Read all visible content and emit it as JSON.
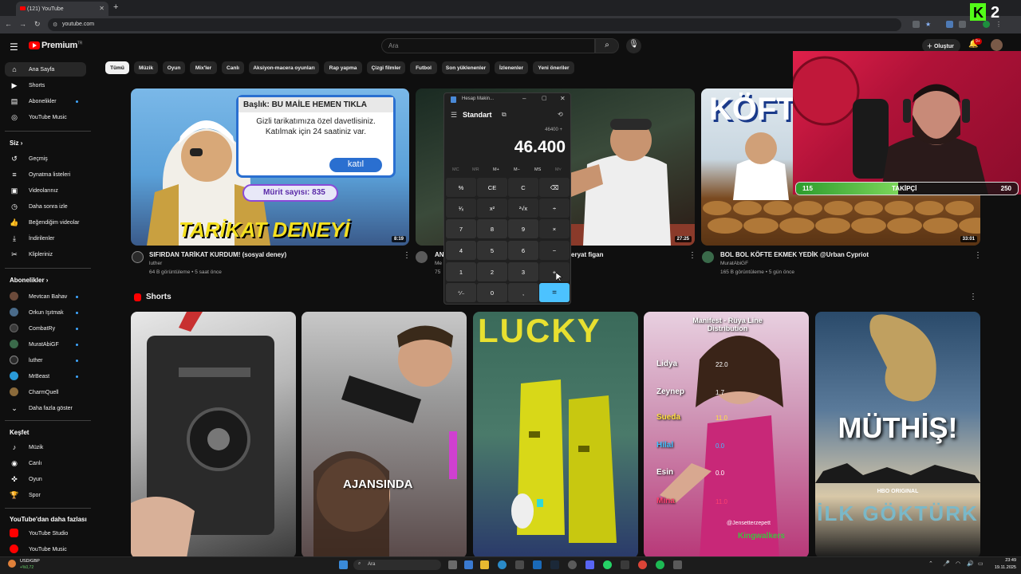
{
  "browser": {
    "tab_title": "(121) YouTube",
    "new_tab": "+",
    "url": "youtube.com"
  },
  "header": {
    "brand": "Premium",
    "brand_sup": "TR",
    "search_placeholder": "Ara",
    "create_label": "Oluştur",
    "notif_count": "9+"
  },
  "chips": [
    "Tümü",
    "Müzik",
    "Oyun",
    "Mix'ler",
    "Canlı",
    "Aksiyon-macera oyunları",
    "Rap yapma",
    "Çizgi filmler",
    "Futbol",
    "Son yüklenenler",
    "İzlenenler",
    "Yeni öneriler"
  ],
  "sidebar": {
    "main": [
      {
        "label": "Ana Sayfa",
        "icon": "home-icon"
      },
      {
        "label": "Shorts",
        "icon": "shorts-icon"
      },
      {
        "label": "Abonelikler",
        "icon": "subscriptions-icon"
      },
      {
        "label": "YouTube Music",
        "icon": "music-icon"
      }
    ],
    "you_header": "Siz",
    "you": [
      {
        "label": "Geçmiş",
        "icon": "history-icon"
      },
      {
        "label": "Oynatma listeleri",
        "icon": "playlist-icon"
      },
      {
        "label": "Videolarınız",
        "icon": "your-videos-icon"
      },
      {
        "label": "Daha sonra izle",
        "icon": "watch-later-icon"
      },
      {
        "label": "Beğendiğim videolar",
        "icon": "like-icon"
      },
      {
        "label": "İndirilenler",
        "icon": "download-icon"
      },
      {
        "label": "Klipleriniz",
        "icon": "clips-icon"
      }
    ],
    "subs_header": "Abonelikler",
    "subs": [
      {
        "label": "Mevtcan Bahav",
        "color": "#6b4a3a"
      },
      {
        "label": "Orkun Işıtmak",
        "color": "#4a6b8a"
      },
      {
        "label": "CombatRy",
        "color": "#3a3a3a"
      },
      {
        "label": "MuratAbiGF",
        "color": "#3a6a4a"
      },
      {
        "label": "luther",
        "color": "#2a2a2a"
      },
      {
        "label": "MrBeast",
        "color": "#2a9ad8"
      },
      {
        "label": "CharmQuell",
        "color": "#8a6a3a"
      }
    ],
    "show_more": "Daha fazla göster",
    "explore_header": "Keşfet",
    "explore": [
      {
        "label": "Müzik",
        "icon": "music-note-icon"
      },
      {
        "label": "Canlı",
        "icon": "live-icon"
      },
      {
        "label": "Oyun",
        "icon": "gaming-icon"
      },
      {
        "label": "Spor",
        "icon": "trophy-icon"
      }
    ],
    "more_header": "YouTube'dan daha fazlası",
    "more": [
      {
        "label": "YouTube Studio"
      },
      {
        "label": "YouTube Music"
      }
    ]
  },
  "videos": [
    {
      "title": "SIFIRDAN TARİKAT KURDUM! (sosyal deney)",
      "channel": "luther",
      "meta": "64 B görüntüleme • 5 saat önce",
      "duration": "8:19",
      "thumb_text": {
        "heading": "Başlık: BU MAİLE HEMEN TIKLA",
        "body1": "Gizli tarikatımıza özel davetlisiniz.",
        "body2": "Katılmak için 24 saatiniz var.",
        "button": "katıl",
        "badge": "Mürit sayısı: 835",
        "caption": "TARİKAT DENEYİ"
      }
    },
    {
      "title": "AN",
      "channel": "Me",
      "meta": "75",
      "duration": "27:25",
      "title_tail": "eryat figan"
    },
    {
      "title": "BOL BOL KÖFTE EKMEK YEDİK @Urban Cypriot",
      "channel": "MuratAbiGF",
      "meta": "165 B görüntüleme • 5 gün önce",
      "duration": "33:01",
      "thumb_caption": "KÖFT"
    }
  ],
  "calculator": {
    "title": "Hesap Makin...",
    "mode": "Standart",
    "expression": "46400 +",
    "display": "46.400",
    "memory": [
      "MC",
      "MR",
      "M+",
      "M−",
      "MS",
      "M˅"
    ],
    "keys": [
      [
        "%",
        "CE",
        "C",
        "⌫"
      ],
      [
        "¹⁄ₓ",
        "x²",
        "²√x",
        "÷"
      ],
      [
        "7",
        "8",
        "9",
        "×"
      ],
      [
        "4",
        "5",
        "6",
        "−"
      ],
      [
        "1",
        "2",
        "3",
        "+"
      ],
      [
        "⁺⁄₋",
        "0",
        ",",
        "="
      ]
    ]
  },
  "overlay": {
    "logo_k": "K",
    "logo_2": "2",
    "follow_current": "115",
    "follow_label": "TAKİPÇİ",
    "follow_goal": "250",
    "follow_progress": 0.46
  },
  "shorts": {
    "header": "Shorts",
    "items": [
      {
        "caption": ""
      },
      {
        "caption": "AJANSINDA"
      },
      {
        "caption": "LUCKY"
      },
      {
        "caption": "Manifest - Rüya Line Distribution",
        "list": [
          [
            "Lidya",
            "22.0"
          ],
          [
            "Zeynep",
            "1.7"
          ],
          [
            "Sueda",
            "11.0"
          ],
          [
            "Hilal",
            "0.0"
          ],
          [
            "Esin",
            "0.0"
          ],
          [
            "Mina",
            "11.0"
          ]
        ],
        "handle": "@Jensetterzepett",
        "footer": "Kingwalkers"
      },
      {
        "caption": "MÜTHİŞ!",
        "sub": "HBO ORIGINAL",
        "footer": "İLK GÖKTÜRK"
      }
    ]
  },
  "taskbar": {
    "ticker_name": "USD/GBP",
    "ticker_change": "+%0,72",
    "search": "Ara",
    "time": "23:49",
    "date": "19.11.2025"
  }
}
